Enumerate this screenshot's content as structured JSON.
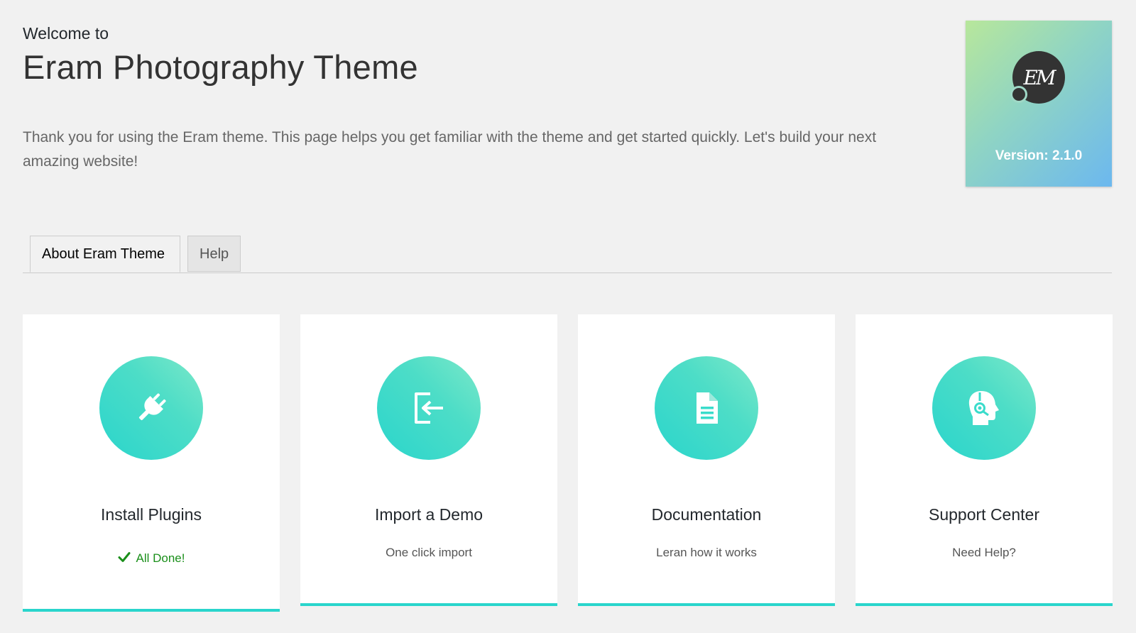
{
  "header": {
    "welcome": "Welcome to",
    "title": "Eram Photography Theme",
    "intro": "Thank you for using the Eram theme. This page helps you get familiar with the theme and get started quickly. Let's build your next amazing website!"
  },
  "badge": {
    "logo_text": "EM",
    "version": "Version: 2.1.0",
    "gradient_colors": [
      "#b8e79b",
      "#8fd4c4",
      "#6cb8ef"
    ]
  },
  "tabs": [
    {
      "label": "About Eram Theme",
      "active": true
    },
    {
      "label": "Help",
      "active": false
    }
  ],
  "cards": [
    {
      "title": "Install Plugins",
      "status": "All Done!",
      "icon": "plug-icon"
    },
    {
      "title": "Import a Demo",
      "subtitle": "One click import",
      "icon": "import-icon"
    },
    {
      "title": "Documentation",
      "subtitle": "Leran how it works",
      "icon": "document-icon"
    },
    {
      "title": "Support Center",
      "subtitle": "Need Help?",
      "icon": "support-headset-icon"
    }
  ],
  "colors": {
    "accent": "#2ad5cc",
    "success": "#1a8f1a",
    "background": "#f1f1f1"
  }
}
